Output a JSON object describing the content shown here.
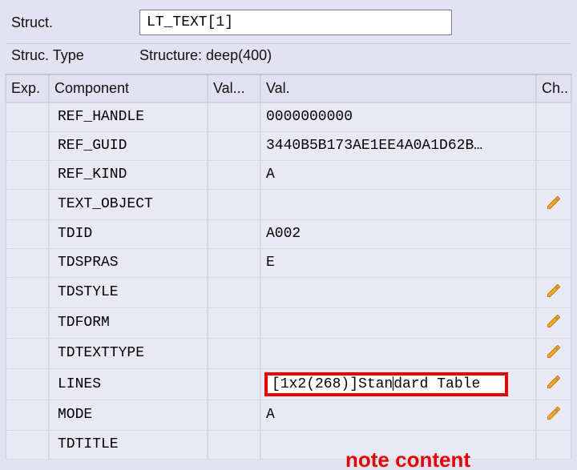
{
  "form": {
    "struct_label": "Struct.",
    "struct_value": "LT_TEXT[1]",
    "struc_type_label": "Struc. Type",
    "struc_type_value": "Structure: deep(400)"
  },
  "columns": {
    "exp": "Exp.",
    "component": "Component",
    "val1": "Val...",
    "val2": "Val.",
    "ch": "Ch.."
  },
  "rows": [
    {
      "component": "REF_HANDLE",
      "val": "0000000000",
      "editable": false
    },
    {
      "component": "REF_GUID",
      "val": "3440B5B173AE1EE4A0A1D62B…",
      "editable": false
    },
    {
      "component": "REF_KIND",
      "val": "A",
      "editable": false
    },
    {
      "component": "TEXT_OBJECT",
      "val": "",
      "editable": true
    },
    {
      "component": "TDID",
      "val": "A002",
      "editable": false
    },
    {
      "component": "TDSPRAS",
      "val": "E",
      "editable": false
    },
    {
      "component": "TDSTYLE",
      "val": "",
      "editable": true
    },
    {
      "component": "TDFORM",
      "val": "",
      "editable": true
    },
    {
      "component": "TDTEXTTYPE",
      "val": "",
      "editable": true
    },
    {
      "component": "LINES",
      "val": "[1x2(268)]Standard Table",
      "editable": true,
      "editing": true,
      "highlight": true
    },
    {
      "component": "MODE",
      "val": "A",
      "editable": true
    },
    {
      "component": "TDTITLE",
      "val": "",
      "editable": false
    }
  ],
  "annotation": "note content",
  "icons": {
    "pencil": "pencil-icon"
  }
}
